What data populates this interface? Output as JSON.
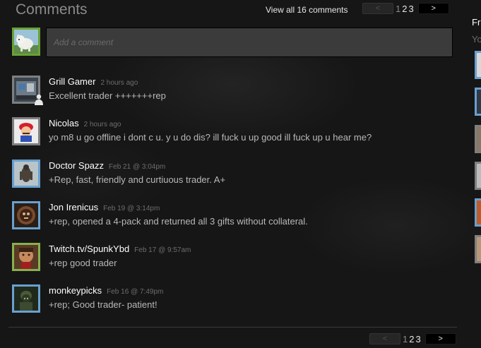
{
  "header": {
    "title": "Comments",
    "view_all": "View all 16 comments"
  },
  "pagination": {
    "prev": "<",
    "next": ">",
    "pages": [
      "1",
      "2",
      "3"
    ],
    "current_page": "1"
  },
  "composer": {
    "placeholder": "Add a comment"
  },
  "comments": [
    {
      "author": "Grill Gamer",
      "time": "2 hours ago",
      "text": "Excellent trader +++++++rep",
      "status": "offline"
    },
    {
      "author": "Nicolas",
      "time": "2 hours ago",
      "text": "yo m8 u go offline i dont c u. y u do dis? ill fuck u up good ill fuck up u hear me?",
      "status": "offline"
    },
    {
      "author": "Doctor Spazz",
      "time": "Feb 21 @ 3:04pm",
      "text": "+Rep, fast, friendly and curtiuous trader. A+",
      "status": "online"
    },
    {
      "author": "Jon Irenicus",
      "time": "Feb 19 @ 3:14pm",
      "text": "+rep, opened a 4-pack and returned all 3 gifts without collateral.",
      "status": "online"
    },
    {
      "author": "Twitch.tv/SpunkYbd",
      "time": "Feb 17 @ 9:57am",
      "text": "+rep good trader",
      "status": "ingame"
    },
    {
      "author": "monkeypicks",
      "time": "Feb 16 @ 7:49pm",
      "text": "+rep; Good trader- patient!",
      "status": "online"
    }
  ],
  "sidebar": {
    "title_fragment": "Fr",
    "subtitle_fragment": "Yo"
  },
  "colors": {
    "background": "#161616",
    "online_border": "#6aa0cf",
    "offline_border": "#7f7f7f",
    "ingame_border": "#86b04d",
    "author_text": "#ffffff",
    "body_text": "#b8b8b8",
    "timestamp_text": "#6d6d6d"
  },
  "icons": {
    "offline_friend_badge": "person-icon"
  }
}
